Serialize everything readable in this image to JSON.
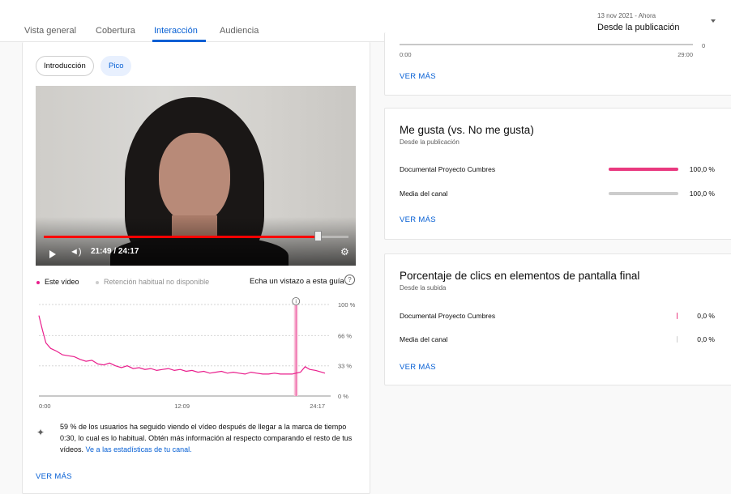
{
  "tabs": [
    {
      "label": "Vista general"
    },
    {
      "label": "Cobertura"
    },
    {
      "label": "Interacción"
    },
    {
      "label": "Audiencia"
    }
  ],
  "date_range": {
    "dates": "13 nov 2021 - Ahora",
    "label": "Desde la publicación"
  },
  "retention": {
    "chips": {
      "intro": "Introducción",
      "pico": "Pico"
    },
    "player": {
      "time": "21:49 / 24:17",
      "progress": 0.9
    },
    "legend": {
      "this_video": "Este vídeo",
      "typical": "Retención habitual no disponible",
      "guide": "Echa un vistazo a esta guía"
    },
    "insight_text": "59 % de los usuarios ha seguido viendo el vídeo después de llegar a la marca de tiempo 0:30, lo cual es lo habitual. Obtén más información al respecto comparando el resto de tus vídeos.",
    "insight_link": "Ve a las estadísticas de tu canal.",
    "see_more": "VER MÁS"
  },
  "chart_data": [
    {
      "type": "line",
      "series": [
        {
          "name": "Este vídeo",
          "color": "#e91e8c",
          "x": [
            0,
            0.3,
            0.6,
            1.0,
            1.5,
            2.0,
            2.5,
            3.0,
            3.5,
            4.0,
            4.5,
            5.0,
            5.5,
            6.0,
            6.5,
            7.0,
            7.5,
            8.0,
            8.5,
            9.0,
            9.5,
            10.0,
            10.5,
            11.0,
            11.5,
            12.0,
            12.5,
            13.0,
            13.5,
            14.0,
            14.5,
            15.0,
            15.5,
            16.0,
            16.5,
            17.0,
            17.5,
            18.0,
            18.5,
            19.0,
            19.5,
            20.0,
            20.5,
            21.0,
            21.5,
            21.82,
            22.2,
            22.6,
            23.0,
            23.5,
            24.0,
            24.28
          ],
          "y": [
            88,
            72,
            58,
            52,
            49,
            45,
            44,
            43,
            40,
            38,
            39,
            35,
            34,
            36,
            33,
            31,
            33,
            30,
            31,
            29,
            30,
            28,
            29,
            30,
            28,
            29,
            27,
            28,
            26,
            27,
            25,
            26,
            27,
            25,
            26,
            25,
            24,
            26,
            25,
            24,
            24,
            25,
            24,
            24,
            24,
            25,
            26,
            32,
            29,
            28,
            26,
            25
          ]
        }
      ],
      "xlim": [
        "0:00",
        "24:17"
      ],
      "x_ticks": [
        "0:00",
        "12:09",
        "24:17"
      ],
      "y_ticks": [
        "100 %",
        "66 %",
        "33 %",
        "0 %"
      ],
      "ylim": [
        0,
        100
      ],
      "marker_x": 21.82
    },
    {
      "type": "line",
      "x_ticks": [
        "0:00",
        "29:00"
      ],
      "y_ticks": [
        "0"
      ]
    }
  ],
  "top_card": {
    "see_more": "VER MÁS"
  },
  "likes_card": {
    "title": "Me gusta (vs. No me gusta)",
    "subtitle": "Desde la publicación",
    "rows": [
      {
        "label": "Documental Proyecto Cumbres",
        "value": "100,0 %",
        "fraction": 1.0,
        "color": "#e9397f"
      },
      {
        "label": "Media del canal",
        "value": "100,0 %",
        "fraction": 1.0,
        "color": "#cccccc"
      }
    ],
    "see_more": "VER MÁS"
  },
  "clicks_card": {
    "title": "Porcentaje de clics en elementos de pantalla final",
    "subtitle": "Desde la subida",
    "rows": [
      {
        "label": "Documental Proyecto Cumbres",
        "value": "0,0 %",
        "fraction": 0.0,
        "color": "#e9397f"
      },
      {
        "label": "Media del canal",
        "value": "0,0 %",
        "fraction": 0.0,
        "color": "#cccccc"
      }
    ],
    "see_more": "VER MÁS"
  }
}
